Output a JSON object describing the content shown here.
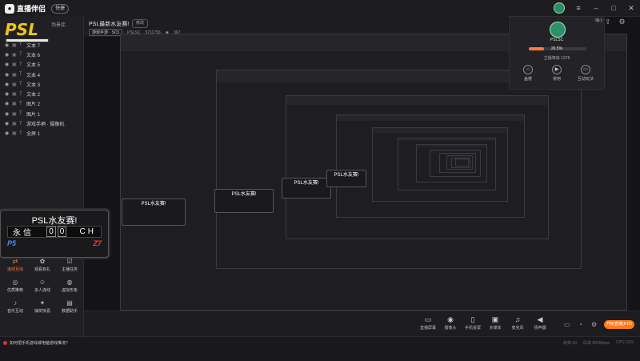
{
  "app": {
    "name": "直播伴侣",
    "version_badge": "快捷"
  },
  "window": {
    "close_symbol": "✕"
  },
  "left": {
    "scene_lib": "场景库",
    "layers": [
      {
        "label": "文本 7"
      },
      {
        "label": "文本 6"
      },
      {
        "label": "文本 5"
      },
      {
        "label": "文本 4"
      },
      {
        "label": "文本 3"
      },
      {
        "label": "文本 2"
      },
      {
        "label": "图片 2"
      },
      {
        "label": "图片 1"
      },
      {
        "label": "游戏手柄 · 摄像机"
      },
      {
        "label": "全屏 1"
      }
    ]
  },
  "score": {
    "title": "PSL水友赛!",
    "left_name": "永信",
    "nums": [
      "0",
      "0"
    ],
    "right_name": "CH",
    "team_left": "P5",
    "team_right": "Z7"
  },
  "tools": [
    {
      "label": "连线互动",
      "icon": "link-icon",
      "hot": true
    },
    {
      "label": "观看有礼",
      "icon": "gift-icon",
      "hot": false
    },
    {
      "label": "主播任务",
      "icon": "task-icon",
      "hot": false
    },
    {
      "label": "优质推荐",
      "icon": "recommend-icon",
      "hot": false
    },
    {
      "label": "多人连线",
      "icon": "multi-icon",
      "hot": false
    },
    {
      "label": "虚拟形象",
      "icon": "avatar-icon",
      "hot": false
    },
    {
      "label": "音乐互动",
      "icon": "music-icon",
      "hot": false
    },
    {
      "label": "抽奖惊喜",
      "icon": "lottery-icon",
      "hot": false
    },
    {
      "label": "数据助手",
      "icon": "data-icon",
      "hot": false
    }
  ],
  "header": {
    "title": "PSL最新水友赛!",
    "edit_badge": "修改",
    "category_tag": "游戏手游 · SC5",
    "room_label": "PSLSC",
    "room_id": "5711756",
    "viewer_count": "367"
  },
  "right": {
    "name": "PSLSC",
    "percent": "26.5%",
    "level_text": "主播等级 1378",
    "progress": 0.265,
    "actions": [
      {
        "label": "盖楼",
        "icon": "house-icon"
      },
      {
        "label": "常用",
        "icon": "play-icon"
      },
      {
        "label": "互动玩法",
        "icon": "monitor-icon"
      }
    ],
    "mini_label": "缩小"
  },
  "bottom": {
    "buttons": [
      {
        "label": "直播屏幕",
        "icon": "screen-icon"
      },
      {
        "label": "摄像头",
        "icon": "camera-icon"
      },
      {
        "label": "手机投屏",
        "icon": "phone-icon"
      },
      {
        "label": "多媒体",
        "icon": "media-icon"
      },
      {
        "label": "麦克风",
        "icon": "mic-icon"
      },
      {
        "label": "扬声器",
        "icon": "speaker-icon"
      }
    ],
    "start_label": "开始直播(F10)"
  },
  "status": {
    "tip": "如何把手机游戏或电脑游戏推流?",
    "right_items": [
      "帧率 60",
      "码率 8000kbps",
      "CPU 12%"
    ]
  },
  "colors": {
    "accent": "#ff7a1a",
    "blue_team": "#4b8cff",
    "red_team": "#ff3b3b"
  }
}
